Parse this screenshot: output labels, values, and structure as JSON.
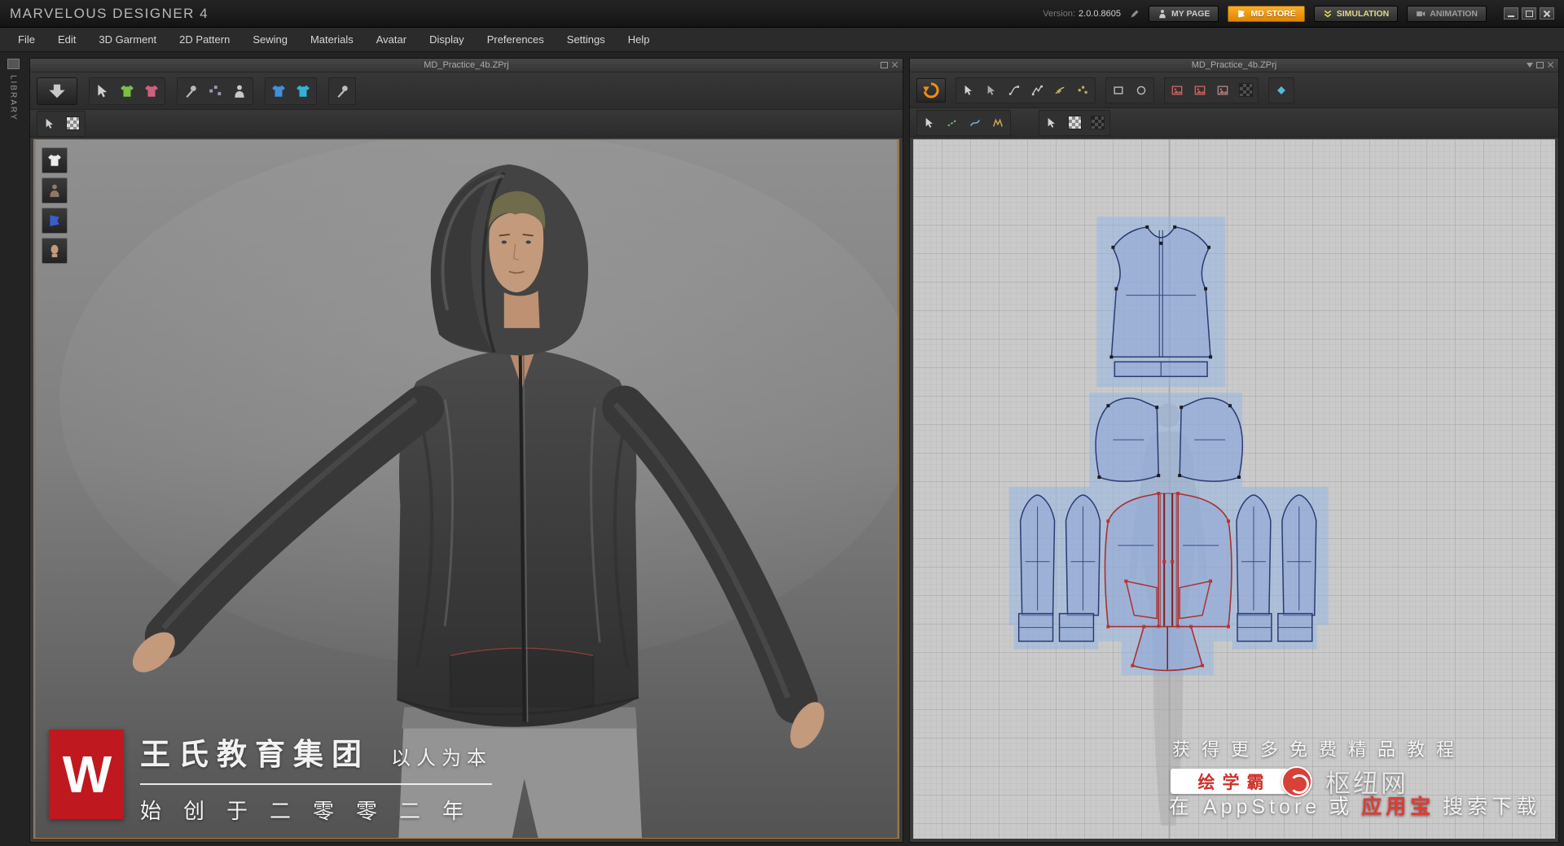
{
  "titlebar": {
    "app_title": "MARVELOUS DESIGNER 4",
    "version_label": "Version:",
    "version_value": "2.0.0.8605",
    "my_page": "MY PAGE",
    "md_store": "MD STORE",
    "simulation": "SIMULATION",
    "animation": "ANIMATION"
  },
  "menubar": {
    "items": [
      "File",
      "Edit",
      "3D Garment",
      "2D Pattern",
      "Sewing",
      "Materials",
      "Avatar",
      "Display",
      "Preferences",
      "Settings",
      "Help"
    ]
  },
  "library_label": "LIBRARY",
  "panel3d": {
    "title": "MD_Practice_4b.ZPrj"
  },
  "panel2d": {
    "title": "MD_Practice_4b.ZPrj"
  },
  "toolbar3d": {
    "tools_row1": [
      "simulate",
      "select-garment",
      "show-garment",
      "garment-color",
      "gizmo-pin",
      "pin-ball",
      "avatar-show",
      "cloth-front",
      "cloth-back",
      "sewing-pin"
    ],
    "tools_row2": [
      "select-texture",
      "texture-toggle"
    ]
  },
  "toolbar2d": {
    "tools_row1": [
      "sync-2d-3d",
      "transform-pattern",
      "edit-pattern",
      "edit-curvature",
      "edit-curve-point",
      "add-point",
      "add-curve",
      "polygon",
      "rectangle",
      "texture-edit",
      "texture-move",
      "texture-image",
      "texture-checker",
      "show-normal"
    ],
    "tools_row2": [
      "select-sewing",
      "edit-sewing",
      "segment-sewing",
      "free-sewing",
      "select-texture-2d",
      "show-texture",
      "show-mesh"
    ]
  },
  "watermark": {
    "logo_letter": "W",
    "brand": "王氏教育集团",
    "slogan": "以人为本",
    "founding": "始创于二零零二年"
  },
  "promo": {
    "line1": "获得更多免费精品教程",
    "badge": "绘学霸",
    "site": "枢纽网",
    "line3_white1": "在 AppStore",
    "line3_white2": "或",
    "line3_red": "应用宝",
    "line3_white3": "搜索下载"
  },
  "colors": {
    "accent_orange": "#ef8e14",
    "store_button": "#e89410",
    "viewport_border": "#b5792b",
    "pattern_fill": "#93a8d6",
    "pattern_stroke": "#2a3a74",
    "selected_stroke": "#a83030",
    "selection_highlight": "#8cb4eb",
    "canvas_bg": "#cacaca",
    "brand_red": "#c0181f"
  }
}
